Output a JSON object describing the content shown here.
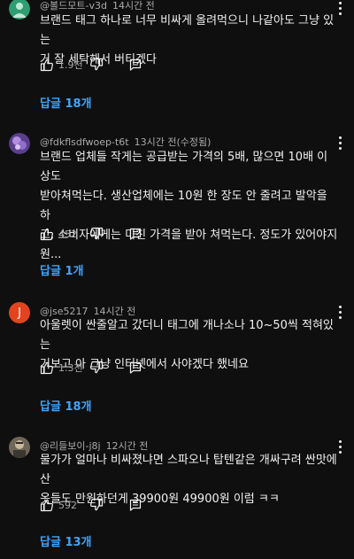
{
  "comments": [
    {
      "handle": "@볼드모트-v3d",
      "time": "14시간 전",
      "text": "브랜드 태그 하나로 너무 비싸게 올려먹으니 나같아도 그냥 있는\n거 잘 세탁해서 버티겠다",
      "likes": "1.9천",
      "replies": "답글 18개",
      "avatar_color": "#2e9d72"
    },
    {
      "handle": "@fdkflsdfwoep-t6t",
      "time": "13시간 전(수정됨)",
      "text": "브랜드 업체들 작게는 공급받는 가격의 5배, 많으면 10배 이상도\n받아쳐먹는다. 생산업체에는 10원 한 장도 안 줄려고 발악을 하\n고, 소비자에게는 미친 가격을 받아 쳐먹는다. 정도가 있어야지\n원...",
      "likes": "452",
      "replies": "답글 1개",
      "avatar_color": "#7a5fb0"
    },
    {
      "handle": "@jse5217",
      "time": "14시간 전",
      "text": "아울렛이 싼줄알고 갔더니 태그에 개나소나 10~50씩 적혀있는\n거보고 아 그냥 인터넷에서 사야겠다 했네요",
      "likes": "1.3천",
      "replies": "답글 18개",
      "avatar_letter": "J",
      "avatar_color": "#e1441e"
    },
    {
      "handle": "@리들보이-j8j",
      "time": "12시간 전",
      "text": "물가가 얼마나 비싸졌냐면 스파오나 탑텐같은 개싸구려 싼맛에 산\n옷들도 만원하던게 39900원 49900원 이럼 ㅋㅋ",
      "likes": "592",
      "replies": "답글 13개",
      "avatar_color": "#8a8070"
    }
  ]
}
